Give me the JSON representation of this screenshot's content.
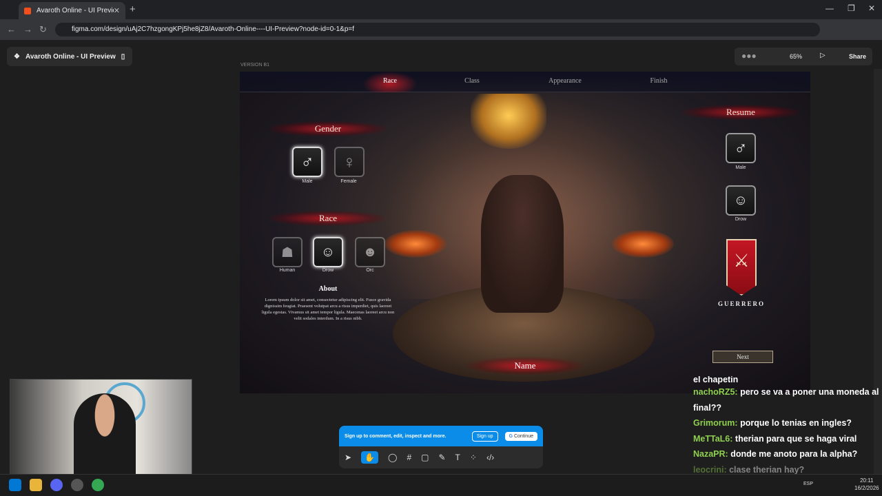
{
  "browser": {
    "tab_title": "Avaroth Online - UI Preview – F",
    "url": "figma.com/design/uAj2C7hzgongKPj5he8jZ8/Avaroth-Online----UI-Preview?node-id=0-1&p=f"
  },
  "figma": {
    "file_name": "Avaroth Online - UI Preview",
    "zoom": "65%",
    "share": "Share",
    "version_label": "VERSION B1"
  },
  "game": {
    "tabs": [
      "Race",
      "Class",
      "Appearance",
      "Finish"
    ],
    "gender_title": "Gender",
    "gender_options": [
      "Male",
      "Female"
    ],
    "race_title": "Race",
    "race_options": [
      "Human",
      "Drow",
      "Orc"
    ],
    "about_title": "About",
    "about_text": "Lorem ipsum dolor sit amet, consectetur adipiscing elit. Fusce gravida dignissim feugiat. Praesent volutpat arcu a risus imperdiet, quis laoreet ligula egestas. Vivamus sit amet tempor ligula. Maecenas laoreet arcu non velit sodales interdum. In a risus nibh.",
    "resume_title": "Resume",
    "resume_gender": "Male",
    "resume_race": "Drow",
    "class_name": "GUERRERO",
    "next": "Next",
    "name_label": "Name"
  },
  "chat": [
    {
      "text": "el chapetin"
    },
    {
      "user": "nachoRZ5:",
      "text": "pero se va a poner una moneda al final??"
    },
    {
      "user": "Grimorum:",
      "text": "porque lo tenias en ingles?"
    },
    {
      "user": "MeTTaL6:",
      "text": "therian para que se haga viral"
    },
    {
      "user": "NazaPR:",
      "text": "donde me anoto para la alpha?"
    },
    {
      "user": "leocrini:",
      "text": "clase therian hay?"
    }
  ],
  "signup": {
    "text": "Sign up to comment, edit, inspect and more.",
    "signup": "Sign up",
    "continue": "Continue"
  },
  "taskbar": {
    "lang": "ESP",
    "time": "20:11",
    "date": "16/2/2026"
  }
}
